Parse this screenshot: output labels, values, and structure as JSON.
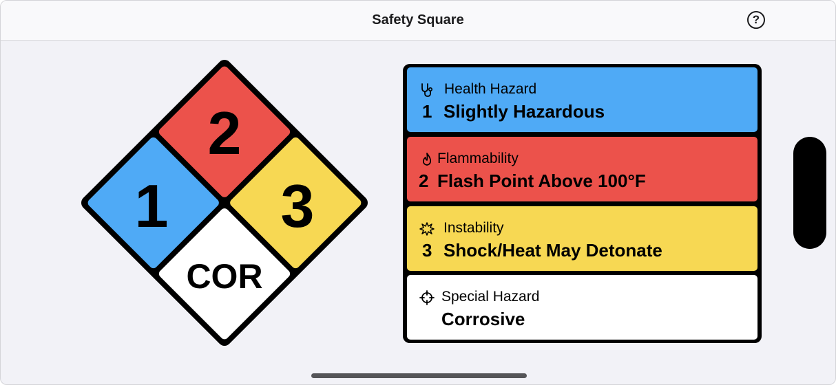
{
  "navbar": {
    "title": "Safety Square",
    "help_label": "?"
  },
  "diamond": {
    "health_value": "1",
    "flammability_value": "2",
    "instability_value": "3",
    "special_value": "COR"
  },
  "hazards": {
    "health": {
      "icon": "stethoscope-icon",
      "title": "Health Hazard",
      "level": "1",
      "description": "Slightly Hazardous",
      "color": "#4faaf6"
    },
    "flammability": {
      "icon": "flame-icon",
      "title": "Flammability",
      "level": "2",
      "description": "Flash Point Above 100°F",
      "color": "#ec524b"
    },
    "instability": {
      "icon": "burst-icon",
      "title": "Instability",
      "level": "3",
      "description": "Shock/Heat May Detonate",
      "color": "#f7d853"
    },
    "special": {
      "icon": "crosshair-icon",
      "title": "Special Hazard",
      "level": "",
      "description": "Corrosive",
      "color": "#ffffff"
    }
  }
}
